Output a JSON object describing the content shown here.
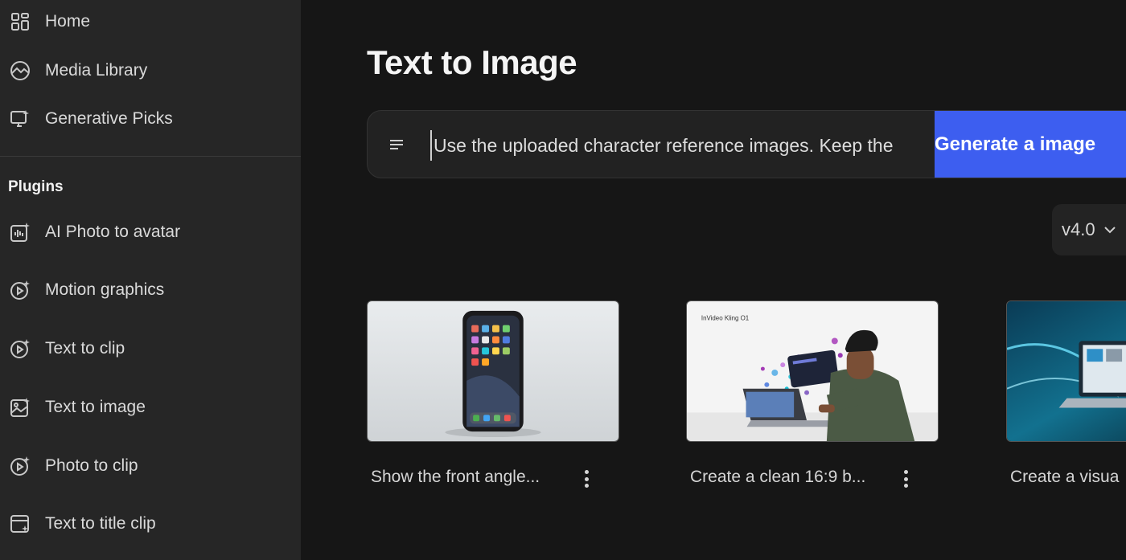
{
  "sidebar": {
    "items": [
      {
        "label": "Home",
        "icon": "grid-icon"
      },
      {
        "label": "Media Library",
        "icon": "image-landscape-icon"
      },
      {
        "label": "Generative Picks",
        "icon": "monitor-sparkle-icon"
      }
    ],
    "plugins_title": "Plugins",
    "plugins": [
      {
        "label": "AI Photo to avatar",
        "icon": "avatar-sparkle-icon"
      },
      {
        "label": "Motion graphics",
        "icon": "play-sparkle-icon"
      },
      {
        "label": "Text to clip",
        "icon": "play-sparkle-icon"
      },
      {
        "label": "Text to image",
        "icon": "image-sparkle-icon"
      },
      {
        "label": "Photo to clip",
        "icon": "play-sparkle-icon"
      },
      {
        "label": "Text to title clip",
        "icon": "window-sparkle-icon"
      }
    ]
  },
  "main": {
    "title": "Text to Image",
    "prompt": {
      "value": "Use the uploaded character reference images. Keep the",
      "generate_label": "Generate a image"
    },
    "version": "v4.0",
    "cards": [
      {
        "caption": "Show the front angle...",
        "thumb": "phone"
      },
      {
        "caption": "Create a clean 16:9 b...",
        "thumb": "man-laptop",
        "thumb_text": "InVideo Kling O1"
      },
      {
        "caption": "Create a visua",
        "thumb": "laptop-blue"
      }
    ]
  },
  "colors": {
    "accent": "#3d5ef0",
    "sidebar_bg": "#262626",
    "main_bg": "#161616"
  }
}
